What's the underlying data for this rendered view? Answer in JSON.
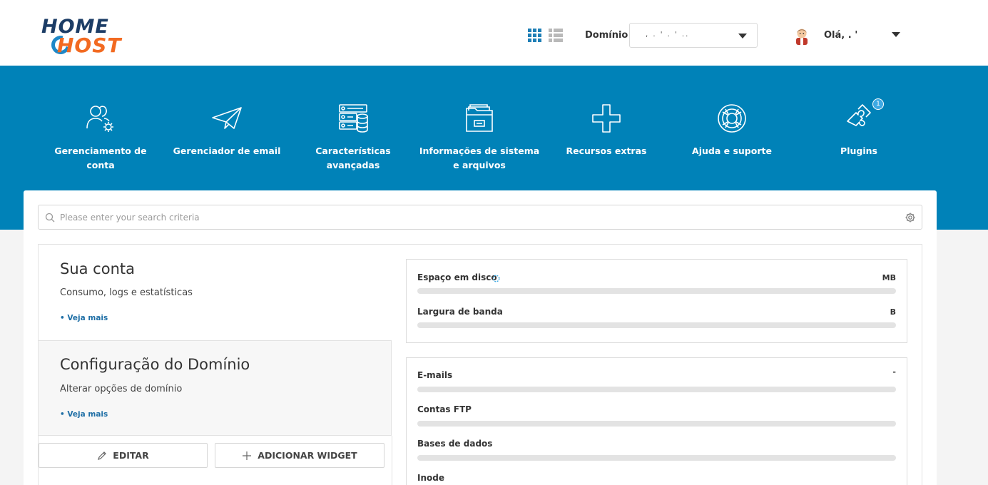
{
  "header": {
    "logo": {
      "line1": "HOME",
      "line2": "HOST"
    },
    "view_icons": [
      "grid-view-icon",
      "list-view-icon"
    ],
    "domain_label": "Domínio",
    "domain_value": ", . ' . ' ..",
    "greeting": "Olá,",
    "user_name": ". '"
  },
  "nav": {
    "items": [
      {
        "label": "Gerenciamento de conta",
        "icon": "users-gear-icon"
      },
      {
        "label": "Gerenciador de email",
        "icon": "paper-plane-icon"
      },
      {
        "label": "Características avançadas",
        "icon": "server-database-icon"
      },
      {
        "label": "Informações de sistema e arquivos",
        "icon": "folder-files-icon"
      },
      {
        "label": "Recursos extras",
        "icon": "plus-icon"
      },
      {
        "label": "Ajuda e suporte",
        "icon": "lifebuoy-icon"
      },
      {
        "label": "Plugins",
        "icon": "puzzle-icon",
        "badge": "1"
      }
    ]
  },
  "search": {
    "placeholder": "Please enter your search criteria"
  },
  "cards": {
    "account": {
      "title": "Sua conta",
      "subtitle": "Consumo, logs e estatísticas",
      "link": "• Veja mais"
    },
    "domain": {
      "title": "Configuração do Domínio",
      "subtitle": "Alterar opções de domínio",
      "link": "• Veja mais"
    }
  },
  "buttons": {
    "edit": "EDITAR",
    "add_widget": "ADICIONAR WIDGET"
  },
  "usage": {
    "resources": [
      {
        "label": "Espaço em disco",
        "unit": "MB",
        "fill": 0
      },
      {
        "label": "Largura de banda",
        "unit": "B",
        "fill": 0
      }
    ],
    "counts": [
      {
        "label": "E-mails",
        "unit": "-",
        "fill": 0
      },
      {
        "label": "Contas FTP",
        "unit": "",
        "fill": 0
      },
      {
        "label": "Bases de dados",
        "unit": "",
        "fill": 0
      },
      {
        "label": "Inode",
        "unit": "",
        "fill": 0
      }
    ]
  },
  "colors": {
    "brand_blue": "#0082b8",
    "logo_navy": "#1c3d66",
    "logo_orange": "#f26a21",
    "link": "#1f6fa6"
  }
}
